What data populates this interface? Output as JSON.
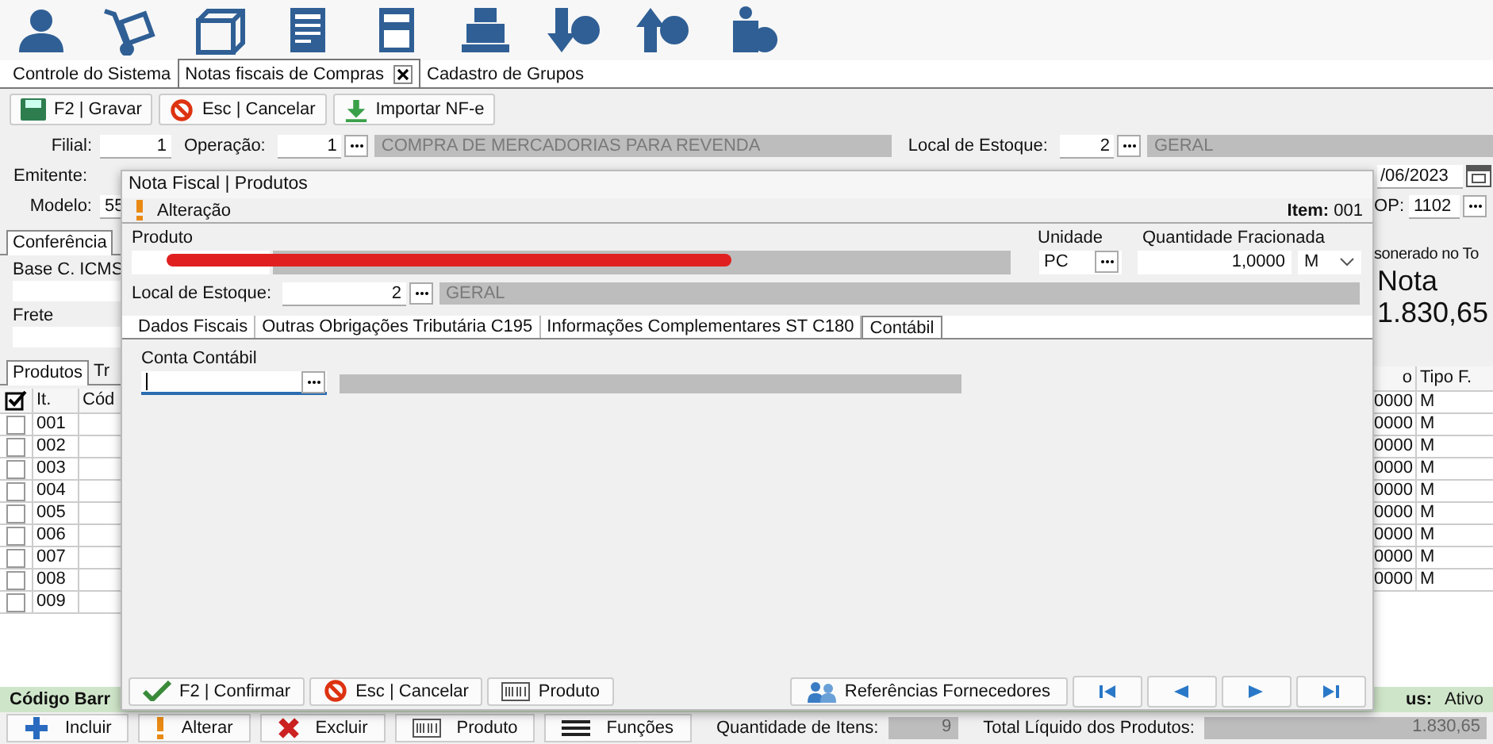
{
  "tabs": [
    {
      "label": "Controle do Sistema",
      "selected": false,
      "closable": false
    },
    {
      "label": "Notas fiscais de Compras",
      "selected": true,
      "closable": true
    },
    {
      "label": "Cadastro de Grupos",
      "selected": false,
      "closable": false
    }
  ],
  "actions": [
    {
      "kind": "save",
      "label": "F2 | Gravar"
    },
    {
      "kind": "cancel",
      "label": "Esc | Cancelar"
    },
    {
      "kind": "import",
      "label": "Importar NF-e"
    }
  ],
  "form": {
    "filial_label": "Filial:",
    "filial": "1",
    "operacao_label": "Operação:",
    "operacao_code": "1",
    "operacao_desc": "COMPRA DE MERCADORIAS PARA REVENDA",
    "local_label": "Local de Estoque:",
    "local_code": "2",
    "local_desc": "GERAL",
    "emitente_label": "Emitente:",
    "date": "/06/2023",
    "modelo_label": "Modelo:",
    "modelo": "55",
    "cfop_label": "OP:",
    "cfop": "1102"
  },
  "summary": {
    "tab": "Conferência",
    "base_label": "Base C. ICMS",
    "frete_label": "Frete",
    "right_label": "sonerado no To",
    "right_title": "Nota",
    "right_value": "1.830,65"
  },
  "item_tabs": [
    {
      "label": "Produtos",
      "selected": true
    },
    {
      "label": "Tr",
      "selected": false
    }
  ],
  "items_table": {
    "columns_left": [
      "It.",
      "Cód"
    ],
    "columns_right": [
      "o",
      "Tipo F."
    ],
    "rows": [
      {
        "checked": false,
        "item": "001",
        "qty": "0000",
        "tipo": "M"
      },
      {
        "checked": false,
        "item": "002",
        "qty": "0000",
        "tipo": "M"
      },
      {
        "checked": false,
        "item": "003",
        "qty": "0000",
        "tipo": "M"
      },
      {
        "checked": false,
        "item": "004",
        "qty": "0000",
        "tipo": "M"
      },
      {
        "checked": false,
        "item": "005",
        "qty": "0000",
        "tipo": "M"
      },
      {
        "checked": false,
        "item": "006",
        "qty": "0000",
        "tipo": "M"
      },
      {
        "checked": false,
        "item": "007",
        "qty": "0000",
        "tipo": "M"
      },
      {
        "checked": false,
        "item": "008",
        "qty": "0000",
        "tipo": "M"
      },
      {
        "checked": false,
        "item": "009",
        "qty": "0000",
        "tipo": "M"
      }
    ]
  },
  "barcode_label": "Código Barr",
  "status_label": "us:",
  "status": "Ativo",
  "bottom_bar": {
    "buttons": [
      {
        "kind": "add",
        "label": "Incluir"
      },
      {
        "kind": "edit",
        "label": "Alterar"
      },
      {
        "kind": "delete",
        "label": "Excluir"
      },
      {
        "kind": "product",
        "label": "Produto"
      },
      {
        "kind": "menu",
        "label": "Funções"
      }
    ],
    "quantity_label": "Quantidade de Itens:",
    "quantity": "9",
    "total_label": "Total Líquido dos Produtos:",
    "total": "1.830,65"
  },
  "dialog": {
    "title": "Nota Fiscal | Produtos",
    "mode": "Alteração",
    "item": "**Item:** 001",
    "produto_label": "Produto",
    "unidade_label": "Unidade",
    "unidade": "PC",
    "quantidade_label": "Quantidade Fracionada",
    "quantidade": "1,0000",
    "tipo": "M",
    "local_label": "Local de Estoque:",
    "local_code": "2",
    "local_desc": "GERAL",
    "tabs": [
      {
        "label": "Dados Fiscais",
        "selected": false
      },
      {
        "label": "Outras Obrigações Tributária C195",
        "selected": false
      },
      {
        "label": "Informações Complementares ST C180",
        "selected": false
      },
      {
        "label": "Contábil",
        "selected": true
      }
    ],
    "conta_label": "Conta Contábil",
    "buttons": [
      {
        "kind": "confirm",
        "label": "F2 | Confirmar"
      },
      {
        "kind": "cancel",
        "label": "Esc | Cancelar"
      },
      {
        "kind": "product",
        "label": "Produto"
      }
    ],
    "reference_button": "Referências Fornecedores",
    "nav": [
      {
        "kind": "first"
      },
      {
        "kind": "previous"
      },
      {
        "kind": "next"
      },
      {
        "kind": "last"
      }
    ]
  }
}
